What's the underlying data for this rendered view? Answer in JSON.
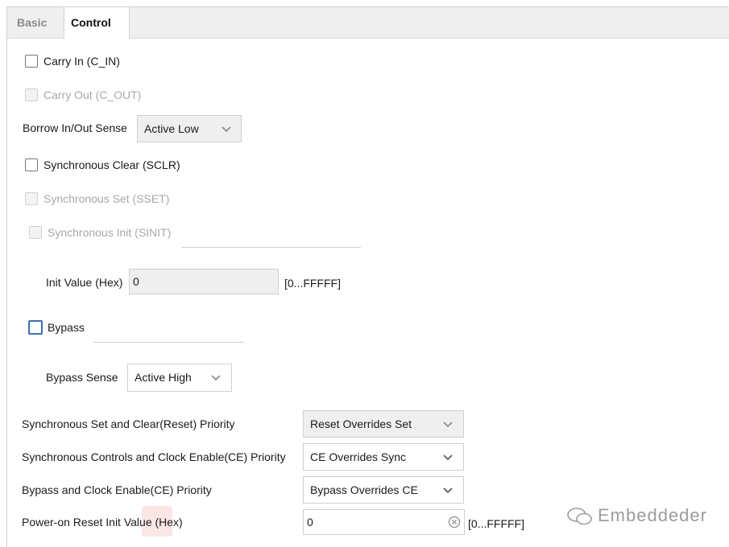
{
  "tabs": {
    "basic": "Basic",
    "control": "Control"
  },
  "carry_in": {
    "label": "Carry In (C_IN)"
  },
  "carry_out": {
    "label": "Carry Out (C_OUT)"
  },
  "borrow": {
    "label": "Borrow In/Out Sense",
    "value": "Active Low"
  },
  "sclr": {
    "label": "Synchronous Clear (SCLR)"
  },
  "sset": {
    "label": "Synchronous Set (SSET)"
  },
  "sinit": {
    "label": "Synchronous Init (SINIT)"
  },
  "init_value": {
    "label": "Init Value (Hex)",
    "value": "0",
    "range": "[0...FFFFF]"
  },
  "bypass": {
    "label": "Bypass"
  },
  "bypass_sense": {
    "label": "Bypass Sense",
    "value": "Active High"
  },
  "priority_set_clear": {
    "label": "Synchronous Set and Clear(Reset) Priority",
    "value": "Reset Overrides Set"
  },
  "priority_ce_sync": {
    "label": "Synchronous Controls and Clock Enable(CE) Priority",
    "value": "CE Overrides Sync"
  },
  "priority_bypass_ce": {
    "label": "Bypass and Clock Enable(CE) Priority",
    "value": "Bypass Overrides CE"
  },
  "power_on_reset": {
    "label": "Power-on Reset Init Value (Hex)",
    "value": "0",
    "range": "[0...FFFFF]"
  },
  "watermark": {
    "text": "Embeddeder"
  }
}
